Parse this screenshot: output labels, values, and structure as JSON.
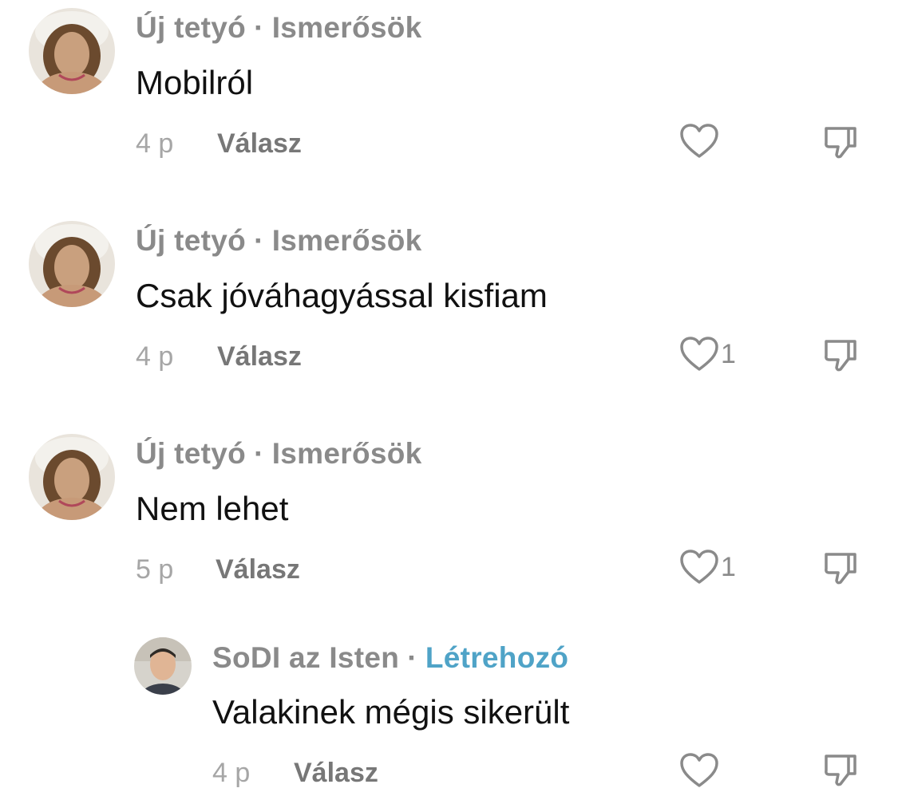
{
  "comments": [
    {
      "author": "Új tetyó",
      "separator": "·",
      "tag": "Ismerősök",
      "text": "Mobilról",
      "time": "4 p",
      "reply_label": "Válasz",
      "likes": ""
    },
    {
      "author": "Új tetyó",
      "separator": "·",
      "tag": "Ismerősök",
      "text": "Csak jóváhagyással kisfiam",
      "time": "4 p",
      "reply_label": "Válasz",
      "likes": "1"
    },
    {
      "author": "Új tetyó",
      "separator": "·",
      "tag": "Ismerősök",
      "text": "Nem lehet",
      "time": "5 p",
      "reply_label": "Válasz",
      "likes": "1"
    },
    {
      "author": "SoDI az Isten",
      "separator": "·",
      "tag": "Létrehozó",
      "text": "Valakinek mégis sikerült",
      "time": "4 p",
      "reply_label": "Válasz",
      "likes": ""
    }
  ],
  "icons": {
    "like": "heart-outline-icon",
    "dislike": "thumbs-down-outline-icon"
  },
  "colors": {
    "creator_tag": "#4fa3c7",
    "text": "#111111",
    "muted": "#8a8a8a"
  }
}
